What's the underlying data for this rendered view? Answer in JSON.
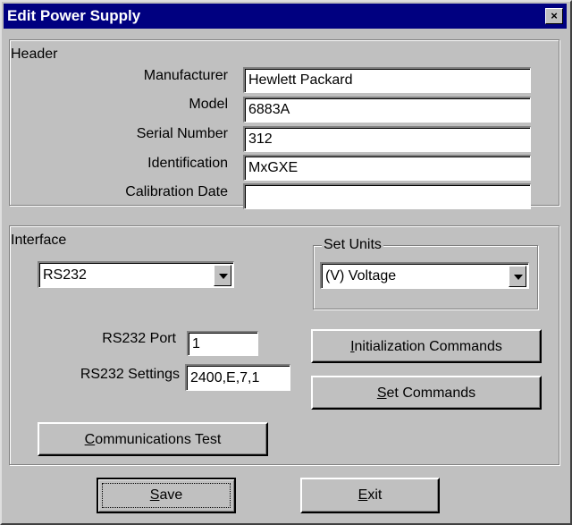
{
  "window": {
    "title": "Edit Power Supply",
    "close_glyph": "×"
  },
  "header": {
    "group_label": "Header",
    "fields": [
      {
        "label": "Manufacturer",
        "value": "Hewlett Packard"
      },
      {
        "label": "Model",
        "value": "6883A"
      },
      {
        "label": "Serial Number",
        "value": "312"
      },
      {
        "label": "Identification",
        "value": "MxGXE"
      },
      {
        "label": "Calibration Date",
        "value": ""
      }
    ]
  },
  "interface": {
    "group_label": "Interface",
    "selected": "RS232",
    "set_units": {
      "group_label": "Set Units",
      "selected": "(V) Voltage"
    },
    "port": {
      "label": "RS232 Port",
      "value": "1"
    },
    "settings": {
      "label": "RS232 Settings",
      "value": "2400,E,7,1"
    },
    "init_button": {
      "mnemonic": "I",
      "rest": "nitialization Commands"
    },
    "set_button": {
      "mnemonic": "S",
      "rest": "et Commands"
    },
    "comm_button": {
      "mnemonic": "C",
      "rest": "ommunications Test"
    }
  },
  "footer": {
    "save_button": {
      "mnemonic": "S",
      "rest": "ave"
    },
    "exit_button": {
      "mnemonic": "E",
      "rest": "xit"
    }
  }
}
